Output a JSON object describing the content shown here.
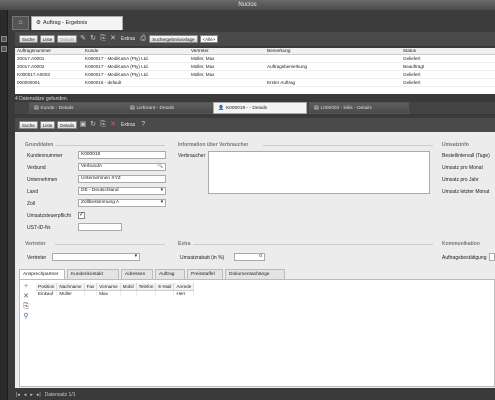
{
  "window": {
    "title": "Nuclos"
  },
  "main_tab": {
    "label": "Auftrag - Ergebnis"
  },
  "toolbar": {
    "search": "Suche",
    "list": "Liste",
    "details": "Details",
    "extras": "Extras",
    "filter_label": "Suchergebnisvorlage",
    "filter_value": "<Alle>"
  },
  "result_table": {
    "columns": [
      "Auftragsnummer",
      "Kunde",
      "Vertreter",
      "Bemerkung",
      "Status"
    ],
    "rows": [
      [
        "20017.A0001",
        "K000017 - MediKaSA (Pty) Ltd.",
        "Müller, Max",
        "",
        "Geliefert"
      ],
      [
        "20017.A0002",
        "K000017 - MediKaSA (Pty) Ltd.",
        "Müller, Max",
        "Auftragsbemerkung",
        "Beauftragt"
      ],
      [
        "K000017.A0003",
        "K000017 - MediKaSA (Pty) Ltd.",
        "Müller, Max",
        "",
        "Geliefert"
      ],
      [
        "000000001",
        "K000016 - default",
        "",
        "Erster Auftrag",
        "Geliefert"
      ]
    ]
  },
  "found_text": "4 Datensätze gefunden.",
  "detail_tabs": [
    {
      "label": "Kunde - Details"
    },
    {
      "label": "Lieferant - Details"
    },
    {
      "label": "K000019 - - Details"
    },
    {
      "label": "L000003 - kiikk - Details"
    }
  ],
  "detail_toolbar": {
    "search": "Suche",
    "list": "Liste",
    "details": "Details",
    "extras": "Extras"
  },
  "sections": {
    "grunddaten": "Grunddaten",
    "info": "Information über Verbraucher",
    "umsatz": "Umsatzinfo",
    "vertreter": "Vertreter",
    "extra": "Extra",
    "kommunikation": "Kommunikation"
  },
  "fields": {
    "kundennummer": {
      "label": "Kundennummer",
      "value": "K000019"
    },
    "verbund": {
      "label": "Verbund",
      "value": "VerbundA"
    },
    "unternehmen": {
      "label": "Unternehmen",
      "value": "Unternehmen XYZ"
    },
    "land": {
      "label": "Land",
      "value": "DE - Deutschland"
    },
    "zoll": {
      "label": "Zoll",
      "value": "Zollbestimmung A"
    },
    "umsatzsteuerpflicht": {
      "label": "Umsatzsteuerpflicht",
      "checked": true
    },
    "ust_id": {
      "label": "UST-ID-Nr.",
      "value": ""
    },
    "verbraucher": {
      "label": "Verbraucher",
      "value": ""
    },
    "bestellintervall": {
      "label": "Bestellintervall (Tage)"
    },
    "umsatz_monat": {
      "label": "Umsatz pro Monat"
    },
    "umsatz_jahr": {
      "label": "Umsatz pro Jahr"
    },
    "umsatz_letzter_monat": {
      "label": "Umsatz letzter Monat"
    },
    "vertreter": {
      "label": "Vertreter",
      "value": ""
    },
    "umsatzrabatt": {
      "label": "Umsatzrabatt (in %)",
      "value": "0"
    },
    "auftragsbestaetigung": {
      "label": "Auftragsbestätigung"
    }
  },
  "sub_tabs": [
    "Ansprechpartner",
    "Kundenkontakt",
    "Adressen",
    "Auftrag",
    "Preisstaffel",
    "Dokumentanhänge"
  ],
  "sub_table": {
    "columns": [
      "Position",
      "Nachname",
      "Fax",
      "Vorname",
      "Mobil",
      "Telefon",
      "E-Mail",
      "Anrede"
    ],
    "rows": [
      [
        "Einkauf",
        "Müller",
        "",
        "Max",
        "",
        "",
        "",
        "Herr"
      ]
    ]
  },
  "status": {
    "text": "Datensatz 1/1"
  }
}
